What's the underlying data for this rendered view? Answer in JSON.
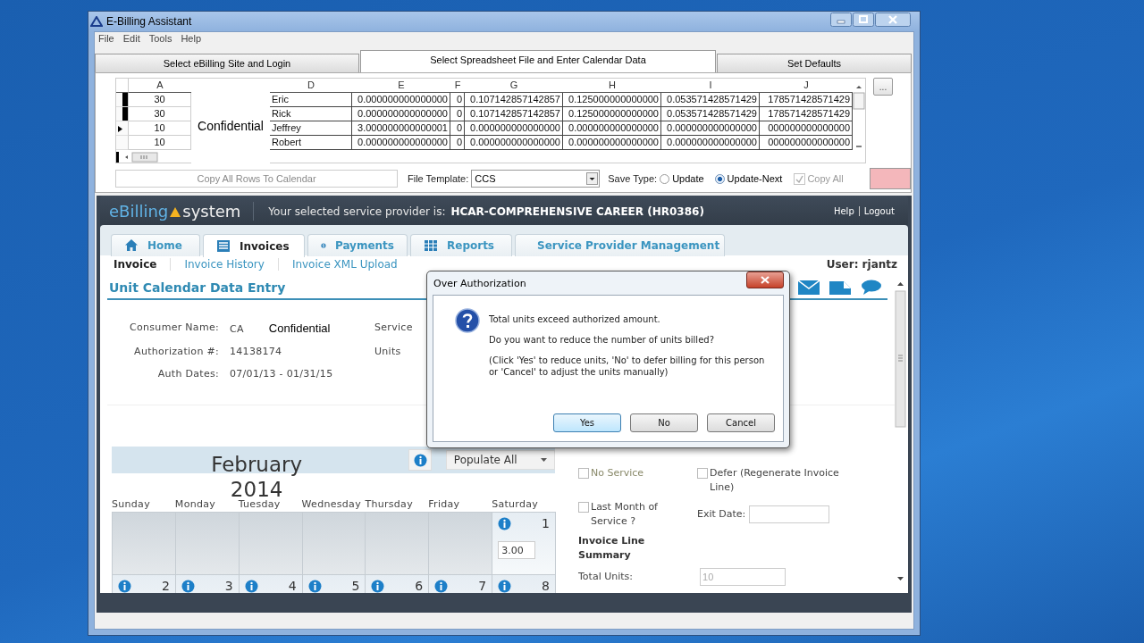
{
  "window": {
    "title": "E-Billing Assistant"
  },
  "menu": [
    "File",
    "Edit",
    "Tools",
    "Help"
  ],
  "tabs": [
    {
      "label": "Select eBilling Site and Login",
      "selected": false
    },
    {
      "label": "Select Spreadsheet File and Enter Calendar Data",
      "selected": true
    },
    {
      "label": "Set Defaults",
      "selected": false
    }
  ],
  "spreadsheet": {
    "columns": [
      "A",
      "D",
      "E",
      "F",
      "G",
      "H",
      "I",
      "J"
    ],
    "redaction": "Confidential",
    "more_button": "...",
    "rows": [
      {
        "selected": true,
        "current": false,
        "cells": [
          "30",
          "Eric",
          "0.000000000000000",
          "0",
          "0.107142857142857",
          "0.125000000000000",
          "0.053571428571429",
          "178571428571429"
        ]
      },
      {
        "selected": true,
        "current": false,
        "cells": [
          "30",
          "Rick",
          "0.000000000000000",
          "0",
          "0.107142857142857",
          "0.125000000000000",
          "0.053571428571429",
          "178571428571429"
        ]
      },
      {
        "selected": false,
        "current": true,
        "cells": [
          "10",
          "Jeffrey",
          "3.000000000000001",
          "0",
          "0.000000000000000",
          "0.000000000000000",
          "0.000000000000000",
          "000000000000000"
        ]
      },
      {
        "selected": false,
        "current": false,
        "cells": [
          "10",
          "Robert",
          "0.000000000000000",
          "0",
          "0.000000000000000",
          "0.000000000000000",
          "0.000000000000000",
          "000000000000000"
        ]
      }
    ]
  },
  "controls": {
    "copy_button": {
      "label": "Copy All Rows To Calendar",
      "disabled": true
    },
    "file_template_label": "File Template:",
    "file_template": "CCS",
    "save_type_label": "Save Type:",
    "save_types": [
      {
        "label": "Update",
        "selected": false
      },
      {
        "label": "Update-Next",
        "selected": true
      }
    ],
    "copy_all": {
      "label": "Copy All",
      "checked": true,
      "disabled": true
    }
  },
  "site": {
    "logo": {
      "first": "eBilling",
      "second": "system"
    },
    "provider_label": "Your selected service provider is:",
    "provider": "HCAR-COMPREHENSIVE CAREER (HR0386)",
    "links": [
      "Help",
      "Logout"
    ],
    "nav": [
      {
        "label": "Home",
        "kind": "home",
        "selected": false
      },
      {
        "label": "Invoices",
        "kind": "invoices",
        "selected": true
      },
      {
        "label": "Payments",
        "kind": "payments",
        "selected": false
      },
      {
        "label": "Reports",
        "kind": "reports",
        "selected": false
      },
      {
        "label": "Service Provider Management",
        "kind": "person",
        "selected": false
      }
    ],
    "subnav": [
      {
        "label": "Invoice",
        "selected": true
      },
      {
        "label": "Invoice History",
        "selected": false
      },
      {
        "label": "Invoice XML Upload",
        "selected": false
      }
    ],
    "user": "User: rjantz"
  },
  "page": {
    "title": "Unit Calendar Data Entry",
    "fields": [
      {
        "label": "Consumer Name:",
        "value": "CA",
        "note": "Confidential"
      },
      {
        "label": "Authorization #:",
        "value": "14138174"
      },
      {
        "label": "Auth Dates:",
        "value": "07/01/13 - 01/31/15"
      }
    ],
    "fields_right": [
      "Service",
      "Units"
    ],
    "calendar": {
      "month": "February",
      "year": "2014",
      "populate": "Populate All",
      "weekdays": [
        "Sunday",
        "Monday",
        "Tuesday",
        "Wednesday",
        "Thursday",
        "Friday",
        "Saturday"
      ],
      "weeks": [
        [
          {
            "kind": "blank"
          },
          {
            "kind": "blank"
          },
          {
            "kind": "blank"
          },
          {
            "kind": "blank"
          },
          {
            "kind": "blank"
          },
          {
            "kind": "blank"
          },
          {
            "kind": "day",
            "day": "1",
            "units": "3.00"
          }
        ],
        [
          {
            "kind": "day",
            "day": "2"
          },
          {
            "kind": "day",
            "day": "3"
          },
          {
            "kind": "day",
            "day": "4"
          },
          {
            "kind": "day",
            "day": "5"
          },
          {
            "kind": "day",
            "day": "6"
          },
          {
            "kind": "day",
            "day": "7"
          },
          {
            "kind": "day",
            "day": "8"
          }
        ]
      ]
    },
    "options": {
      "no_service": {
        "label": "No Service",
        "checked": false
      },
      "defer": {
        "label": "Defer (Regenerate Invoice Line)",
        "checked": false
      },
      "last_month": {
        "label": "Last Month of Service ?",
        "checked": false
      },
      "exit_date_label": "Exit Date:"
    },
    "summary": {
      "title": "Invoice Line Summary",
      "total_label": "Total Units:",
      "total_value": "10",
      "disabled": true
    }
  },
  "dialog": {
    "title": "Over Authorization",
    "lines": [
      "Total units exceed authorized amount.",
      "Do you want to reduce the number of units billed?",
      "(Click 'Yes' to reduce units, 'No' to defer billing for this person or 'Cancel' to adjust the units manually)"
    ],
    "buttons": [
      {
        "label": "Yes",
        "focused": true
      },
      {
        "label": "No",
        "focused": false
      },
      {
        "label": "Cancel",
        "focused": false
      }
    ]
  }
}
